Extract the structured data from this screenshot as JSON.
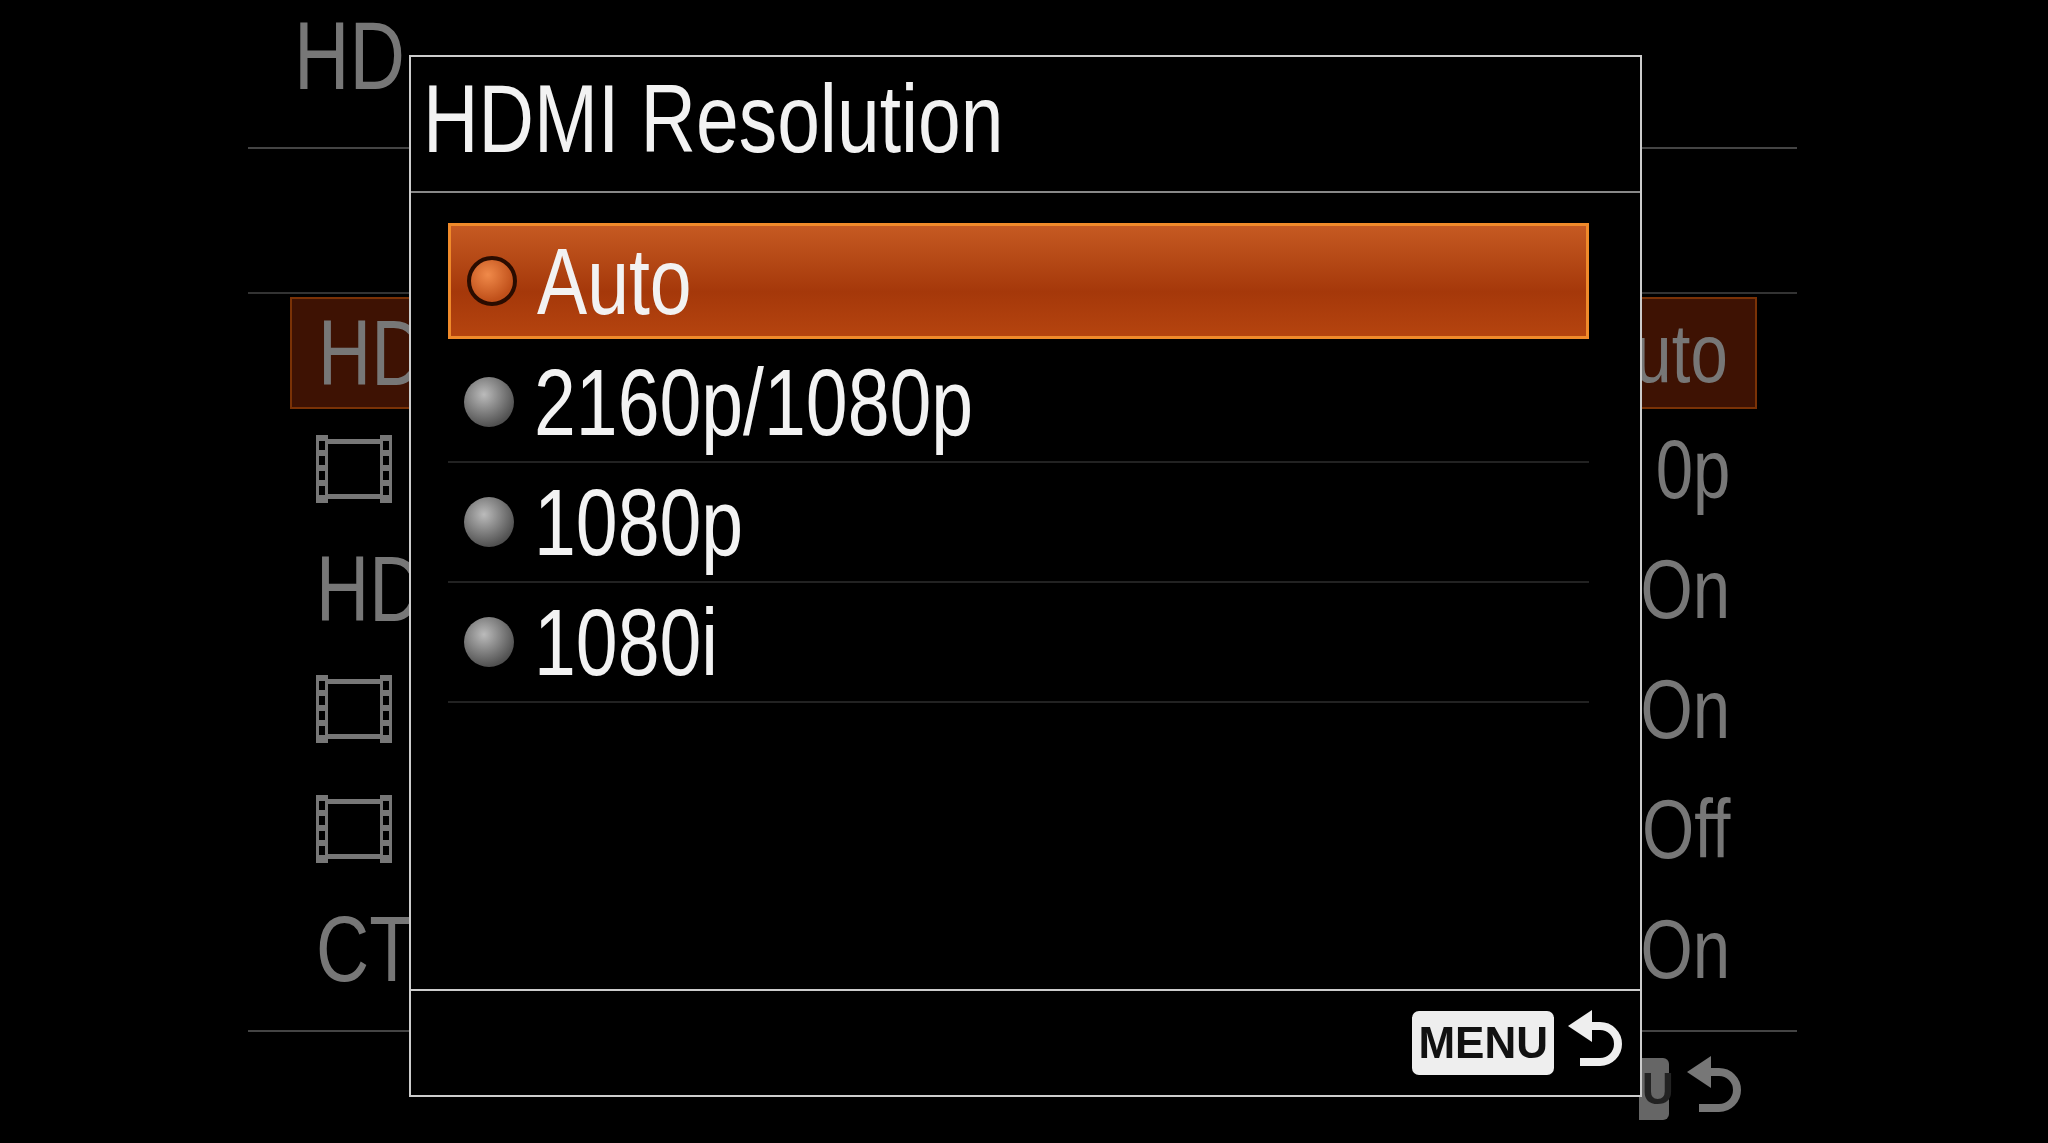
{
  "background_menu": {
    "title": "HD",
    "rows": [
      {
        "kind": "text",
        "label": "HD",
        "value": "uto",
        "selected": true
      },
      {
        "kind": "icon",
        "value": "0p",
        "selected": false
      },
      {
        "kind": "text",
        "label": "HD",
        "value": "On",
        "selected": false
      },
      {
        "kind": "icon",
        "value": "On",
        "selected": false
      },
      {
        "kind": "icon",
        "value": "Off",
        "selected": false
      },
      {
        "kind": "text",
        "label": "CT",
        "value": "On",
        "selected": false
      }
    ],
    "menu_key": "U"
  },
  "dialog": {
    "title": "HDMI Resolution",
    "options": [
      {
        "label": "Auto",
        "selected": true
      },
      {
        "label": "2160p/1080p",
        "selected": false
      },
      {
        "label": "1080p",
        "selected": false
      },
      {
        "label": "1080i",
        "selected": false
      }
    ],
    "menu_key": "MENU"
  }
}
